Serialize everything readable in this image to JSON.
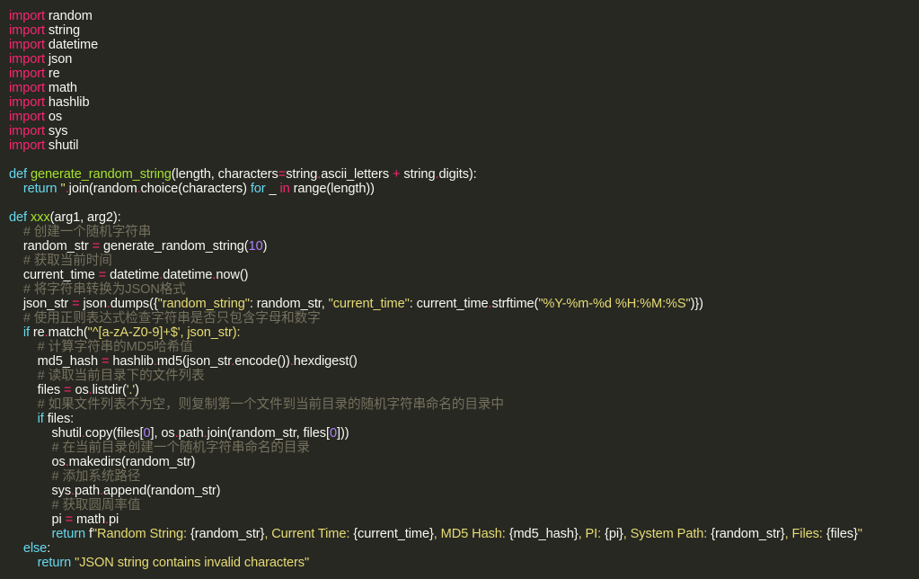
{
  "lines": [
    [
      {
        "t": "import",
        "c": "kw"
      },
      {
        "t": " random",
        "c": "pl"
      }
    ],
    [
      {
        "t": "import",
        "c": "kw"
      },
      {
        "t": " string",
        "c": "pl"
      }
    ],
    [
      {
        "t": "import",
        "c": "kw"
      },
      {
        "t": " datetime",
        "c": "pl"
      }
    ],
    [
      {
        "t": "import",
        "c": "kw"
      },
      {
        "t": " json",
        "c": "pl"
      }
    ],
    [
      {
        "t": "import",
        "c": "kw"
      },
      {
        "t": " re",
        "c": "pl"
      }
    ],
    [
      {
        "t": "import",
        "c": "kw"
      },
      {
        "t": " math",
        "c": "pl"
      }
    ],
    [
      {
        "t": "import",
        "c": "kw"
      },
      {
        "t": " hashlib",
        "c": "pl"
      }
    ],
    [
      {
        "t": "import",
        "c": "kw"
      },
      {
        "t": " os",
        "c": "pl"
      }
    ],
    [
      {
        "t": "import",
        "c": "kw"
      },
      {
        "t": " sys",
        "c": "pl"
      }
    ],
    [
      {
        "t": "import",
        "c": "kw"
      },
      {
        "t": " shutil",
        "c": "pl"
      }
    ],
    [],
    [
      {
        "t": "def",
        "c": "bi"
      },
      {
        "t": " ",
        "c": "pl"
      },
      {
        "t": "generate_random_string",
        "c": "fn"
      },
      {
        "t": "(length, characters",
        "c": "pl"
      },
      {
        "t": "=",
        "c": "op"
      },
      {
        "t": "string",
        "c": "pl"
      },
      {
        "t": ".",
        "c": "op"
      },
      {
        "t": "ascii_letters ",
        "c": "pl"
      },
      {
        "t": "+",
        "c": "op"
      },
      {
        "t": " string",
        "c": "pl"
      },
      {
        "t": ".",
        "c": "op"
      },
      {
        "t": "digits):",
        "c": "pl"
      }
    ],
    [
      {
        "t": "    ",
        "c": "pl"
      },
      {
        "t": "return",
        "c": "bi"
      },
      {
        "t": " ",
        "c": "pl"
      },
      {
        "t": "''",
        "c": "str"
      },
      {
        "t": ".",
        "c": "op"
      },
      {
        "t": "join(random",
        "c": "pl"
      },
      {
        "t": ".",
        "c": "op"
      },
      {
        "t": "choice(characters) ",
        "c": "pl"
      },
      {
        "t": "for",
        "c": "bi"
      },
      {
        "t": " _ ",
        "c": "pl"
      },
      {
        "t": "in",
        "c": "op"
      },
      {
        "t": " range(length))",
        "c": "pl"
      }
    ],
    [],
    [
      {
        "t": "def",
        "c": "bi"
      },
      {
        "t": " ",
        "c": "pl"
      },
      {
        "t": "xxx",
        "c": "fn"
      },
      {
        "t": "(arg1, arg2):",
        "c": "pl"
      }
    ],
    [
      {
        "t": "    ",
        "c": "pl"
      },
      {
        "t": "# 创建一个随机字符串",
        "c": "com"
      }
    ],
    [
      {
        "t": "    random_str ",
        "c": "pl"
      },
      {
        "t": "=",
        "c": "op"
      },
      {
        "t": " generate_random_string(",
        "c": "pl"
      },
      {
        "t": "10",
        "c": "num"
      },
      {
        "t": ")",
        "c": "pl"
      }
    ],
    [
      {
        "t": "    ",
        "c": "pl"
      },
      {
        "t": "# 获取当前时间",
        "c": "com"
      }
    ],
    [
      {
        "t": "    current_time ",
        "c": "pl"
      },
      {
        "t": "=",
        "c": "op"
      },
      {
        "t": " datetime",
        "c": "pl"
      },
      {
        "t": ".",
        "c": "op"
      },
      {
        "t": "datetime",
        "c": "pl"
      },
      {
        "t": ".",
        "c": "op"
      },
      {
        "t": "now()",
        "c": "pl"
      }
    ],
    [
      {
        "t": "    ",
        "c": "pl"
      },
      {
        "t": "# 将字符串转换为JSON格式",
        "c": "com"
      }
    ],
    [
      {
        "t": "    json_str ",
        "c": "pl"
      },
      {
        "t": "=",
        "c": "op"
      },
      {
        "t": " json",
        "c": "pl"
      },
      {
        "t": ".",
        "c": "op"
      },
      {
        "t": "dumps({",
        "c": "pl"
      },
      {
        "t": "\"random_string\"",
        "c": "str"
      },
      {
        "t": ": random_str, ",
        "c": "pl"
      },
      {
        "t": "\"current_time\"",
        "c": "str"
      },
      {
        "t": ": current_time",
        "c": "pl"
      },
      {
        "t": ".",
        "c": "op"
      },
      {
        "t": "strftime(",
        "c": "pl"
      },
      {
        "t": "\"%Y-%m-%d %H:%M:%S\"",
        "c": "str"
      },
      {
        "t": ")})",
        "c": "pl"
      }
    ],
    [
      {
        "t": "    ",
        "c": "pl"
      },
      {
        "t": "# 使用正则表达式检查字符串是否只包含字母和数字",
        "c": "com"
      }
    ],
    [
      {
        "t": "    ",
        "c": "pl"
      },
      {
        "t": "if",
        "c": "bi"
      },
      {
        "t": " re",
        "c": "pl"
      },
      {
        "t": ".",
        "c": "op"
      },
      {
        "t": "match(",
        "c": "pl"
      },
      {
        "t": "\"^[a-zA-Z0-9]+$'",
        "c": "str"
      },
      {
        "t": ", json_str):",
        "c": "str"
      }
    ],
    [
      {
        "t": "        ",
        "c": "pl"
      },
      {
        "t": "# 计算字符串的MD5哈希值",
        "c": "com"
      }
    ],
    [
      {
        "t": "        md5_hash ",
        "c": "pl"
      },
      {
        "t": "=",
        "c": "op"
      },
      {
        "t": " hashlib",
        "c": "pl"
      },
      {
        "t": ".",
        "c": "op"
      },
      {
        "t": "md5(json_str",
        "c": "pl"
      },
      {
        "t": ".",
        "c": "op"
      },
      {
        "t": "encode())",
        "c": "pl"
      },
      {
        "t": ".",
        "c": "op"
      },
      {
        "t": "hexdigest()",
        "c": "pl"
      }
    ],
    [
      {
        "t": "        ",
        "c": "pl"
      },
      {
        "t": "# 读取当前目录下的文件列表",
        "c": "com"
      }
    ],
    [
      {
        "t": "        files ",
        "c": "pl"
      },
      {
        "t": "=",
        "c": "op"
      },
      {
        "t": " os",
        "c": "pl"
      },
      {
        "t": ".",
        "c": "op"
      },
      {
        "t": "listdir(",
        "c": "pl"
      },
      {
        "t": "'.'",
        "c": "str"
      },
      {
        "t": ")",
        "c": "pl"
      }
    ],
    [
      {
        "t": "        ",
        "c": "pl"
      },
      {
        "t": "# 如果文件列表不为空，则复制第一个文件到当前目录的随机字符串命名的目录中",
        "c": "com"
      }
    ],
    [
      {
        "t": "        ",
        "c": "pl"
      },
      {
        "t": "if",
        "c": "bi"
      },
      {
        "t": " files:",
        "c": "pl"
      }
    ],
    [
      {
        "t": "            shutil",
        "c": "pl"
      },
      {
        "t": ".",
        "c": "op"
      },
      {
        "t": "copy(files[",
        "c": "pl"
      },
      {
        "t": "0",
        "c": "num"
      },
      {
        "t": "], os",
        "c": "pl"
      },
      {
        "t": ".",
        "c": "op"
      },
      {
        "t": "path",
        "c": "pl"
      },
      {
        "t": ".",
        "c": "op"
      },
      {
        "t": "join(random_str, files[",
        "c": "pl"
      },
      {
        "t": "0",
        "c": "num"
      },
      {
        "t": "]))",
        "c": "pl"
      }
    ],
    [
      {
        "t": "            ",
        "c": "pl"
      },
      {
        "t": "# 在当前目录创建一个随机字符串命名的目录",
        "c": "com"
      }
    ],
    [
      {
        "t": "            os",
        "c": "pl"
      },
      {
        "t": ".",
        "c": "op"
      },
      {
        "t": "makedirs(random_str)",
        "c": "pl"
      }
    ],
    [
      {
        "t": "            ",
        "c": "pl"
      },
      {
        "t": "# 添加系统路径",
        "c": "com"
      }
    ],
    [
      {
        "t": "            sys",
        "c": "pl"
      },
      {
        "t": ".",
        "c": "op"
      },
      {
        "t": "path",
        "c": "pl"
      },
      {
        "t": ".",
        "c": "op"
      },
      {
        "t": "append(random_str)",
        "c": "pl"
      }
    ],
    [
      {
        "t": "            ",
        "c": "pl"
      },
      {
        "t": "# 获取圆周率值",
        "c": "com"
      }
    ],
    [
      {
        "t": "            pi ",
        "c": "pl"
      },
      {
        "t": "=",
        "c": "op"
      },
      {
        "t": " math",
        "c": "pl"
      },
      {
        "t": ".",
        "c": "op"
      },
      {
        "t": "pi",
        "c": "pl"
      }
    ],
    [
      {
        "t": "            ",
        "c": "pl"
      },
      {
        "t": "return",
        "c": "bi"
      },
      {
        "t": " f",
        "c": "pl"
      },
      {
        "t": "\"Random String: ",
        "c": "str"
      },
      {
        "t": "{random_str}",
        "c": "pl"
      },
      {
        "t": ", Current Time: ",
        "c": "str"
      },
      {
        "t": "{current_time}",
        "c": "pl"
      },
      {
        "t": ", MD5 Hash: ",
        "c": "str"
      },
      {
        "t": "{md5_hash}",
        "c": "pl"
      },
      {
        "t": ", PI: ",
        "c": "str"
      },
      {
        "t": "{pi}",
        "c": "pl"
      },
      {
        "t": ", System Path: ",
        "c": "str"
      },
      {
        "t": "{random_str}",
        "c": "pl"
      },
      {
        "t": ", Files: ",
        "c": "str"
      },
      {
        "t": "{files}",
        "c": "pl"
      },
      {
        "t": "\"",
        "c": "str"
      }
    ],
    [
      {
        "t": "    ",
        "c": "pl"
      },
      {
        "t": "else",
        "c": "bi"
      },
      {
        "t": ":",
        "c": "pl"
      }
    ],
    [
      {
        "t": "        ",
        "c": "pl"
      },
      {
        "t": "return",
        "c": "bi"
      },
      {
        "t": " ",
        "c": "pl"
      },
      {
        "t": "\"JSON string contains invalid characters\"",
        "c": "str"
      }
    ]
  ]
}
